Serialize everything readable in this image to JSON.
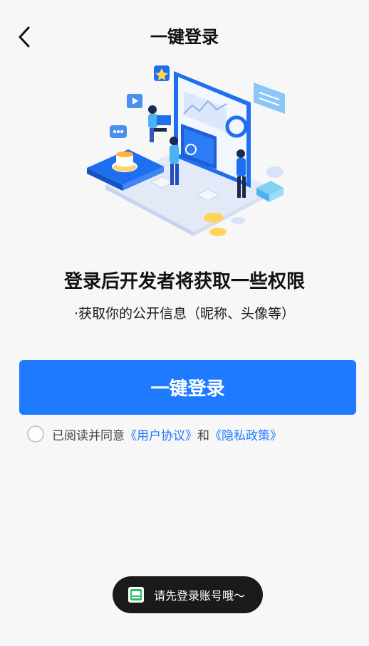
{
  "header": {
    "back_icon": "chevron-left-icon",
    "title": "一键登录"
  },
  "permission": {
    "title": "登录后开发者将获取一些权限",
    "items": [
      "·获取你的公开信息（昵称、头像等）"
    ]
  },
  "login_button": {
    "label": "一键登录"
  },
  "agreement": {
    "prefix": "已阅读并同意",
    "user_agreement": "《用户协议》",
    "conjunction": "和",
    "privacy_policy": "《隐私政策》",
    "checked": false
  },
  "toast": {
    "icon": "app-logo-icon",
    "text": "请先登录账号哦～"
  },
  "colors": {
    "accent": "#1e7bff",
    "background": "#f7f7f7",
    "toast_bg": "#1a1a1a"
  }
}
